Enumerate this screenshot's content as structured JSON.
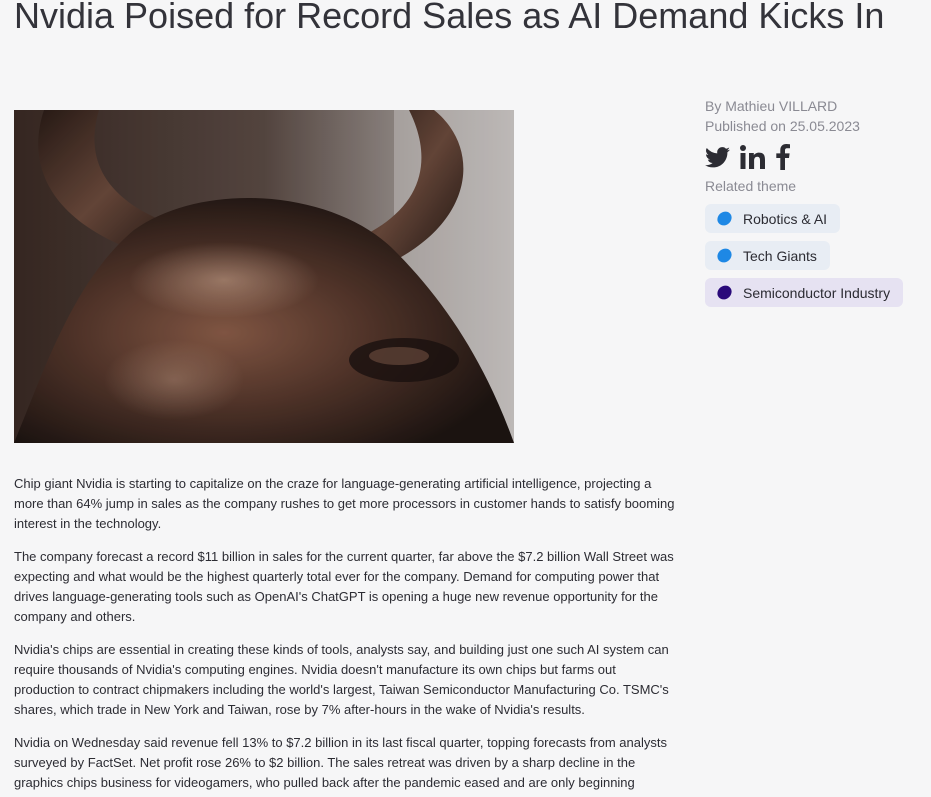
{
  "article": {
    "title": "Nvidia Poised for Record Sales as AI Demand Kicks In",
    "paragraphs": [
      "Chip giant Nvidia is starting to capitalize on the craze for language-generating artificial intelligence, projecting a more than 64% jump in sales as the company rushes to get more processors in customer hands to satisfy booming interest in the technology.",
      "The company forecast a record $11 billion in sales for the current quarter, far above the $7.2 billion Wall Street was expecting and what would be the highest quarterly total ever for the company. Demand for computing power that drives language-generating tools such as OpenAI's ChatGPT is opening a huge new revenue opportunity for the company and others.",
      "Nvidia's chips are essential in creating these kinds of tools, analysts say, and building just one such AI system can require thousands of Nvidia's computing engines. Nvidia doesn't manufacture its own chips but farms out production to contract chipmakers including the world's largest, Taiwan Semiconductor Manufacturing Co. TSMC's shares, which trade in New York and Taiwan, rose by 7% after-hours in the wake of Nvidia's results.",
      "Nvidia on Wednesday said revenue fell 13% to $7.2 billion in its last fiscal quarter, topping forecasts from analysts surveyed by FactSet. Net profit rose 26% to $2 billion. The sales retreat was driven by a sharp decline in the graphics chips business for videogamers, who pulled back after the pandemic eased and are only beginning"
    ]
  },
  "sidebar": {
    "author": "By Mathieu VILLARD",
    "published": "Published on 25.05.2023",
    "social_icons": [
      "twitter-icon",
      "linkedin-icon",
      "facebook-icon"
    ],
    "related_label": "Related theme",
    "themes": [
      {
        "label": "Robotics & AI",
        "dot_color": "#1e88e5",
        "bg": "#e8edf4"
      },
      {
        "label": "Tech Giants",
        "dot_color": "#1e88e5",
        "bg": "#e8edf4"
      },
      {
        "label": "Semiconductor Industry",
        "dot_color": "#2a0a7a",
        "bg": "#e6e2f2"
      }
    ]
  },
  "colors": {
    "background": "#f6f6f7",
    "text": "#2c2c33",
    "muted": "#8a8a93"
  }
}
